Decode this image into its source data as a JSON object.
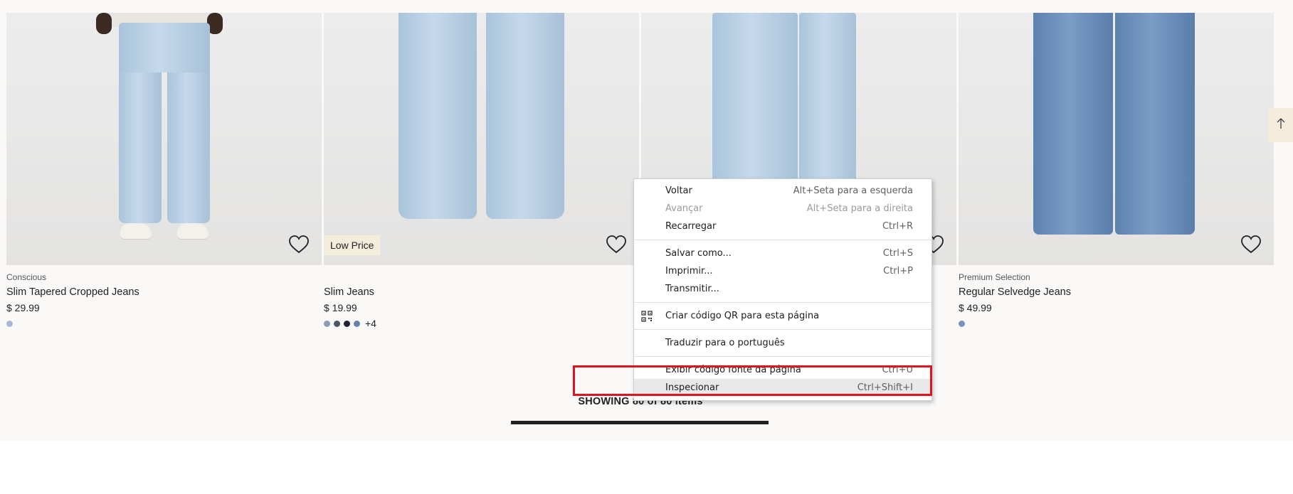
{
  "products": [
    {
      "brand_label": "Conscious",
      "name": "Slim Tapered Cropped Jeans",
      "price": "$ 29.99",
      "badge": "",
      "swatches": [
        "#a8b8d8"
      ],
      "more_colors": "",
      "image_icon": "jeans-model-photo"
    },
    {
      "brand_label": "",
      "name": "Slim Jeans",
      "price": "$ 19.99",
      "badge": "Low Price",
      "swatches": [
        "#8b9bb4",
        "#4b5568",
        "#1f2430",
        "#6c7fa8"
      ],
      "more_colors": "+4",
      "image_icon": "jeans-product-photo"
    },
    {
      "brand_label": "",
      "name": "",
      "price": "",
      "badge": "",
      "swatches": [],
      "more_colors": "",
      "image_icon": "jeans-model-photo"
    },
    {
      "brand_label": "Premium Selection",
      "name": "Regular Selvedge Jeans",
      "price": "$ 49.99",
      "badge": "",
      "swatches": [
        "#7d92b8"
      ],
      "more_colors": "",
      "image_icon": "jeans-product-photo"
    }
  ],
  "pagination": {
    "showing_text": "SHOWING 80 of 80 items",
    "progress_fraction": 1.0
  },
  "context_menu": {
    "groups": [
      [
        {
          "label": "Voltar",
          "shortcut": "Alt+Seta para a esquerda",
          "disabled": false
        },
        {
          "label": "Avançar",
          "shortcut": "Alt+Seta para a direita",
          "disabled": true
        },
        {
          "label": "Recarregar",
          "shortcut": "Ctrl+R",
          "disabled": false
        }
      ],
      [
        {
          "label": "Salvar como...",
          "shortcut": "Ctrl+S",
          "disabled": false
        },
        {
          "label": "Imprimir...",
          "shortcut": "Ctrl+P",
          "disabled": false
        },
        {
          "label": "Transmitir...",
          "shortcut": "",
          "disabled": false
        }
      ],
      [
        {
          "label": "Criar código QR para esta página",
          "shortcut": "",
          "disabled": false,
          "icon": "qr-code-icon"
        }
      ],
      [
        {
          "label": "Traduzir para o português",
          "shortcut": "",
          "disabled": false
        }
      ],
      [
        {
          "label": "Exibir código fonte da página",
          "shortcut": "Ctrl+U",
          "disabled": false
        },
        {
          "label": "Inspecionar",
          "shortcut": "Ctrl+Shift+I",
          "disabled": false,
          "highlighted": true
        }
      ]
    ]
  },
  "colors": {
    "page_background": "#faf9f8",
    "badge_background": "#f5eddc",
    "annotation_red": "#e0141e",
    "progress_fill": "#222222"
  }
}
